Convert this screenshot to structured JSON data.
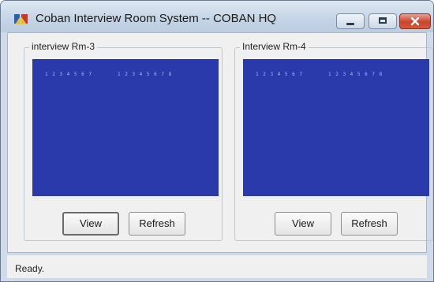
{
  "window": {
    "title": "Coban Interview Room System -- COBAN HQ",
    "icon": "app-icon",
    "controls": [
      "minimize-icon",
      "maximize-icon",
      "close-icon"
    ]
  },
  "rooms": [
    {
      "name": "interview Rm-3",
      "view_label": "View",
      "refresh_label": "Refresh",
      "video_osd_left": "1 2 3 4  5 6 7",
      "video_osd_right": "1 2 3 4 5 6 7 8"
    },
    {
      "name": "Interview Rm-4",
      "view_label": "View",
      "refresh_label": "Refresh",
      "video_osd_left": "1 2 3 4  5 6 7",
      "video_osd_right": "1 2 3 4 5 6 7 8"
    }
  ],
  "statusbar": {
    "text": "Ready."
  },
  "colors": {
    "video_background": "#2a3aaa",
    "close_button": "#c9442c",
    "title_gradient_top": "#dde7f2"
  }
}
